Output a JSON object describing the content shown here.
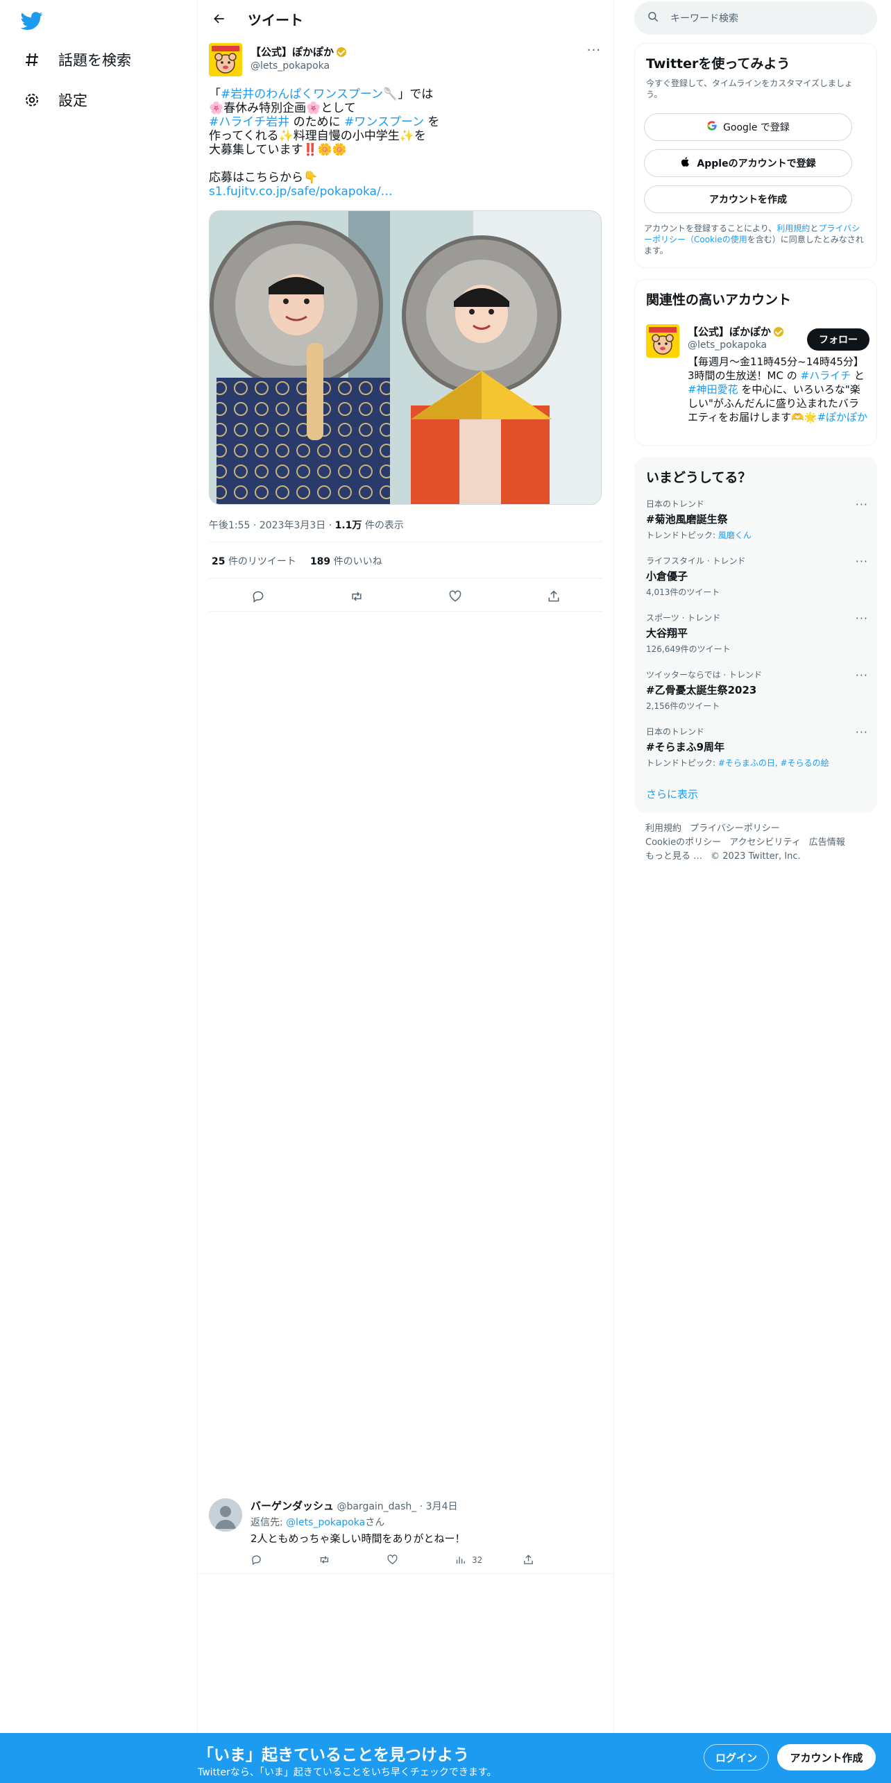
{
  "nav": {
    "items": [
      {
        "icon": "hashtag-icon",
        "label": "話題を検索"
      },
      {
        "icon": "gear-icon",
        "label": "設定"
      }
    ]
  },
  "header": {
    "title": "ツイート"
  },
  "tweet": {
    "author_name": "【公式】ぽかぽか",
    "author_handle": "@lets_pokapoka",
    "text_lines": [
      [
        "「",
        "#岩井のわんぱくワンスプーン",
        "🥄」では"
      ],
      [
        "🌸春休み特別企画🌸として"
      ],
      [
        "#ハライチ岩井",
        " のために ",
        "#ワンスプーン",
        " を"
      ],
      [
        "作ってくれる✨料理自慢の小中学生✨を"
      ],
      [
        "大募集しています‼️🌼🌼"
      ],
      [
        ""
      ],
      [
        "応募はこちらから👇"
      ],
      [
        "s1.fujitv.co.jp/safe/pokapoka/…"
      ]
    ],
    "time": "午後1:55",
    "date": "2023年3月3日",
    "views_count": "1.1万",
    "views_label": "件の表示",
    "retweets_count": "25",
    "retweets_label": "件のリツイート",
    "likes_count": "189",
    "likes_label": "件のいいね"
  },
  "reply": {
    "name": "バーゲンダッシュ",
    "handle": "@bargain_dash_",
    "date": "3月4日",
    "replying_to_prefix": "返信先: ",
    "replying_to_handle": "@lets_pokapoka",
    "replying_to_suffix": "さん",
    "text": "2人ともめっちゃ楽しい時間をありがとねー！",
    "views": "32"
  },
  "search": {
    "placeholder": "キーワード検索"
  },
  "signup": {
    "title": "Twitterを使ってみよう",
    "subtitle": "今すぐ登録して、タイムラインをカスタマイズしましょう。",
    "google": "Google で登録",
    "apple": "Appleのアカウントで登録",
    "create": "アカウントを作成",
    "terms_1": "アカウントを登録することにより、",
    "terms_link1": "利用規約",
    "terms_2": "と",
    "terms_link2": "プライバシーポリシー（Cookieの使用",
    "terms_3": "を含む）に同意したとみなされます。"
  },
  "related": {
    "title": "関連性の高いアカウント",
    "name": "【公式】ぽかぽか",
    "handle": "@lets_pokapoka",
    "follow": "フォロー",
    "bio_1": "【毎週月〜金11時45分~14時45分】3時間の生放送！MC の ",
    "bio_link1": "#ハライチ",
    "bio_2": " と ",
    "bio_link2": "#神田愛花",
    "bio_3": " を中心に、いろいろな\"楽しい\"がふんだんに盛り込まれたバラエティをお届けします🫶🌟",
    "bio_link3": "#ぽかぽか"
  },
  "trends": {
    "title": "いまどうしてる？",
    "items": [
      {
        "category": "日本のトレンド",
        "name": "#菊池風磨誕生祭",
        "sub_prefix": "トレンドトピック: ",
        "sub_link": "風磨くん"
      },
      {
        "category": "ライフスタイル · トレンド",
        "name": "小倉優子",
        "sub_prefix": "4,013件のツイート",
        "sub_link": ""
      },
      {
        "category": "スポーツ · トレンド",
        "name": "大谷翔平",
        "sub_prefix": "126,649件のツイート",
        "sub_link": ""
      },
      {
        "category": "ツイッターならでは · トレンド",
        "name": "#乙骨憂太誕生祭2023",
        "sub_prefix": "2,156件のツイート",
        "sub_link": ""
      },
      {
        "category": "日本のトレンド",
        "name": "#そらまふ9周年",
        "sub_prefix": "トレンドトピック: ",
        "sub_link": "#そらまふの日, #そらるの絵"
      }
    ],
    "show_more": "さらに表示"
  },
  "footer": {
    "links": [
      "利用規約",
      "プライバシーポリシー",
      "Cookieのポリシー",
      "アクセシビリティ",
      "広告情報",
      "もっと見る …"
    ],
    "copyright": "© 2023 Twitter, Inc."
  },
  "bottombar": {
    "title": "「いま」起きていることを見つけよう",
    "subtitle": "Twitterなら、「いま」起きていることをいち早くチェックできます。",
    "login": "ログイン",
    "signup": "アカウント作成"
  },
  "colors": {
    "accent": "#1d9bf0",
    "text": "#0f1419",
    "muted": "#536471"
  }
}
